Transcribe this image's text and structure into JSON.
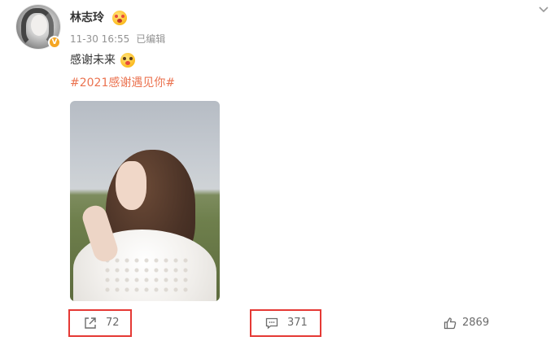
{
  "post": {
    "username": "林志玲",
    "timestamp": "11-30 16:55",
    "edited_label": "已编辑",
    "text": "感谢未来",
    "hashtag": "#2021感谢遇见你#"
  },
  "icons": {
    "username_emoji": "heart-eyes-emoji-icon",
    "text_emoji": "kiss-emoji-icon",
    "verified": "verified-badge-icon",
    "expand": "chevron-down-icon",
    "share": "share-icon",
    "comment": "comment-icon",
    "like": "thumbs-up-icon"
  },
  "actions": {
    "share_count": "72",
    "comment_count": "371",
    "like_count": "2869"
  },
  "colors": {
    "hashtag": "#eb7350",
    "meta": "#939393",
    "highlight_box": "#e53935",
    "verified_badge": "#f5a623"
  }
}
